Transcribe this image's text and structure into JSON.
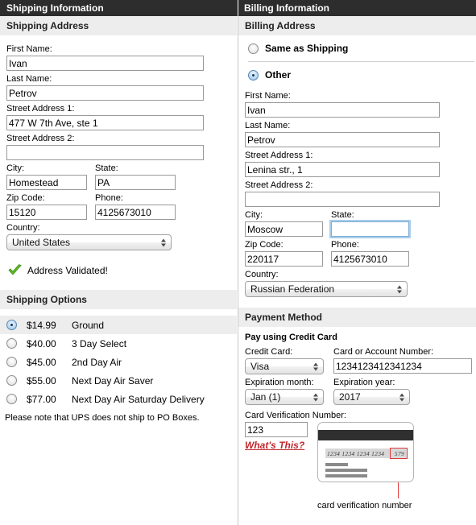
{
  "header": {
    "shipping_title": "Shipping Information",
    "billing_title": "Billing Information"
  },
  "shipping": {
    "address_section": "Shipping Address",
    "labels": {
      "first_name": "First Name:",
      "last_name": "Last Name:",
      "street1": "Street Address 1:",
      "street2": "Street Address 2:",
      "city": "City:",
      "state": "State:",
      "zip": "Zip Code:",
      "phone": "Phone:",
      "country": "Country:"
    },
    "values": {
      "first_name": "Ivan",
      "last_name": "Petrov",
      "street1": "477 W 7th Ave, ste 1",
      "street2": "",
      "city": "Homestead",
      "state": "PA",
      "zip": "15120",
      "phone": "4125673010",
      "country": "United States"
    },
    "validated_text": "Address Validated!",
    "options_section": "Shipping Options",
    "options": [
      {
        "price": "$14.99",
        "name": "Ground",
        "selected": true
      },
      {
        "price": "$40.00",
        "name": "3 Day Select",
        "selected": false
      },
      {
        "price": "$45.00",
        "name": "2nd Day Air",
        "selected": false
      },
      {
        "price": "$55.00",
        "name": "Next Day Air Saver",
        "selected": false
      },
      {
        "price": "$77.00",
        "name": "Next Day Air Saturday Delivery",
        "selected": false
      }
    ],
    "options_note": "Please note that UPS does not ship to PO Boxes."
  },
  "billing": {
    "address_section": "Billing Address",
    "same_as_shipping_label": "Same as Shipping",
    "other_label": "Other",
    "same_as_shipping_selected": false,
    "other_selected": true,
    "labels": {
      "first_name": "First Name:",
      "last_name": "Last Name:",
      "street1": "Street Address 1:",
      "street2": "Street Address 2:",
      "city": "City:",
      "state": "State:",
      "zip": "Zip Code:",
      "phone": "Phone:",
      "country": "Country:"
    },
    "values": {
      "first_name": "Ivan",
      "last_name": "Petrov",
      "street1": "Lenina str., 1",
      "street2": "",
      "city": "Moscow",
      "state": "",
      "zip": "220117",
      "phone": "4125673010",
      "country": "Russian Federation"
    },
    "state_focused": true
  },
  "payment": {
    "section": "Payment Method",
    "hint": "Pay using Credit Card",
    "labels": {
      "credit_card": "Credit Card:",
      "card_number": "Card or Account Number:",
      "exp_month": "Expiration month:",
      "exp_year": "Expiration year:",
      "cvn": "Card Verification Number:"
    },
    "values": {
      "credit_card": "Visa",
      "card_number": "1234123412341234",
      "exp_month": "Jan (1)",
      "exp_year": "2017",
      "cvn": "123"
    },
    "whats_this": "What's This?",
    "card_art": {
      "number_text": "1234 1234 1234 1234",
      "cvn_text": "579",
      "caption": "card verification number"
    }
  },
  "colors": {
    "titlebar_bg": "#2d2d2d",
    "section_bg": "#ededed",
    "focus_ring": "#aacdea",
    "link_red": "#c1272d",
    "validated_green": "#5fb728"
  }
}
